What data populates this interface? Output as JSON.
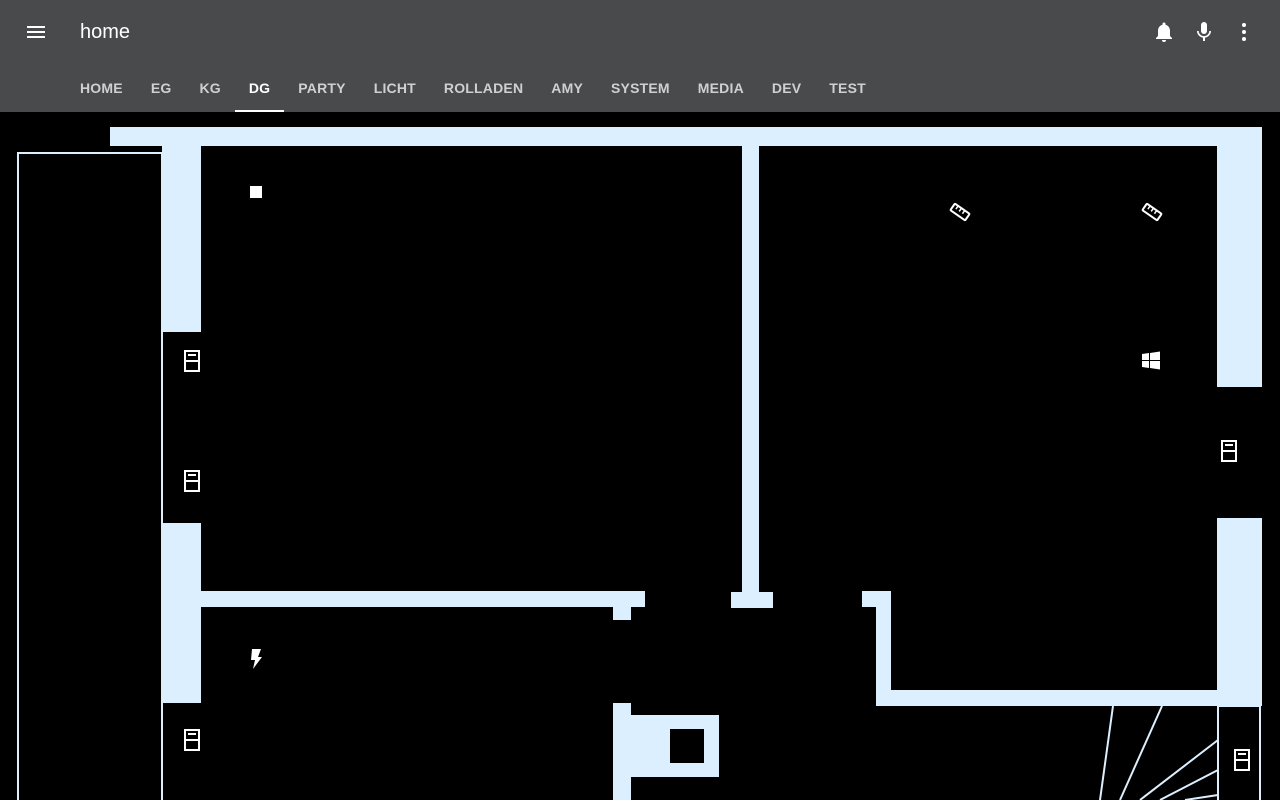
{
  "app": {
    "title": "home"
  },
  "header": {
    "menu_icon": "menu-icon",
    "actions": [
      {
        "name": "notifications",
        "icon": "bell-icon"
      },
      {
        "name": "voice",
        "icon": "microphone-icon"
      },
      {
        "name": "more",
        "icon": "more-vert-icon"
      }
    ]
  },
  "tabs": [
    {
      "label": "HOME"
    },
    {
      "label": "EG"
    },
    {
      "label": "KG"
    },
    {
      "label": "DG",
      "active": true
    },
    {
      "label": "PARTY"
    },
    {
      "label": "LICHT"
    },
    {
      "label": "ROLLADEN"
    },
    {
      "label": "AMY"
    },
    {
      "label": "SYSTEM"
    },
    {
      "label": "MEDIA"
    },
    {
      "label": "DEV"
    },
    {
      "label": "TEST"
    }
  ],
  "colors": {
    "header_bg": "#494a4c",
    "wall": "#dcefff",
    "floor": "#000000",
    "text": "#ffffff"
  },
  "floorplan": {
    "entities": [
      {
        "name": "light-square",
        "icon": "square-icon"
      },
      {
        "name": "window-sensor-left-top",
        "icon": "window-closed-icon"
      },
      {
        "name": "window-sensor-left-middle",
        "icon": "window-closed-icon"
      },
      {
        "name": "power-sensor",
        "icon": "flash-icon"
      },
      {
        "name": "window-sensor-left-bottom",
        "icon": "window-closed-icon"
      },
      {
        "name": "thermometer-1",
        "icon": "thermometer-icon"
      },
      {
        "name": "thermometer-2",
        "icon": "thermometer-icon"
      },
      {
        "name": "windows-pc",
        "icon": "windows-icon"
      },
      {
        "name": "window-sensor-right",
        "icon": "window-closed-icon"
      },
      {
        "name": "window-sensor-right-bottom",
        "icon": "window-closed-icon"
      }
    ]
  }
}
